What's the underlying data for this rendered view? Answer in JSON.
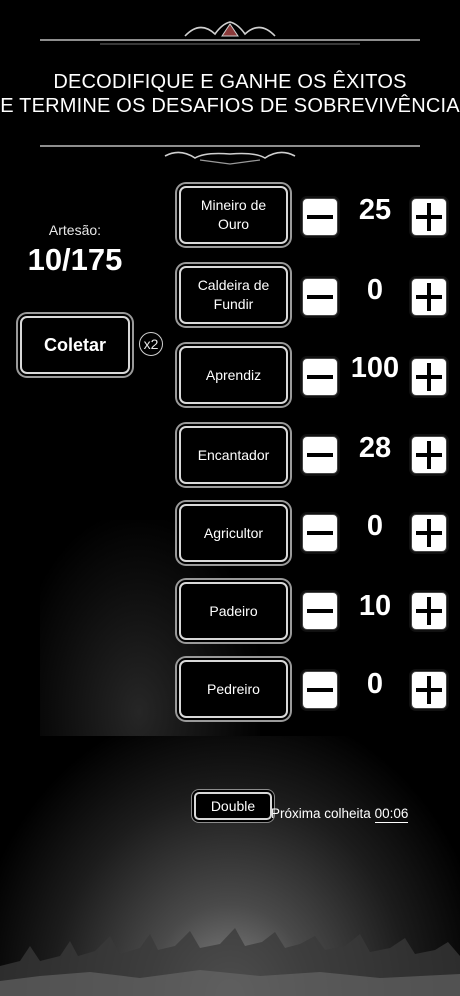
{
  "header": {
    "title_line1": "DECODIFIQUE E GANHE OS ÊXITOS",
    "title_line2": "E TERMINE OS DESAFIOS DE SOBREVIVÊNCIA"
  },
  "artisan": {
    "label": "Artesão:",
    "count": "10/175",
    "collect_label": "Coletar",
    "multiplier_label": "x2"
  },
  "jobs": [
    {
      "name": "Mineiro de Ouro",
      "count": "25"
    },
    {
      "name": "Caldeira de Fundir",
      "count": "0"
    },
    {
      "name": "Aprendiz",
      "count": "100"
    },
    {
      "name": "Encantador",
      "count": "28"
    },
    {
      "name": "Agricultor",
      "count": "0"
    },
    {
      "name": "Padeiro",
      "count": "10"
    },
    {
      "name": "Pedreiro",
      "count": "0"
    }
  ],
  "footer": {
    "double_label": "Double",
    "next_harvest_label": "Próxima colheita",
    "next_harvest_time": "00:06"
  },
  "icons": {
    "minus": "minus-icon",
    "plus": "plus-icon"
  },
  "colors": {
    "background": "#000000",
    "text": "#ffffff",
    "frame": "#d9d9d9"
  }
}
